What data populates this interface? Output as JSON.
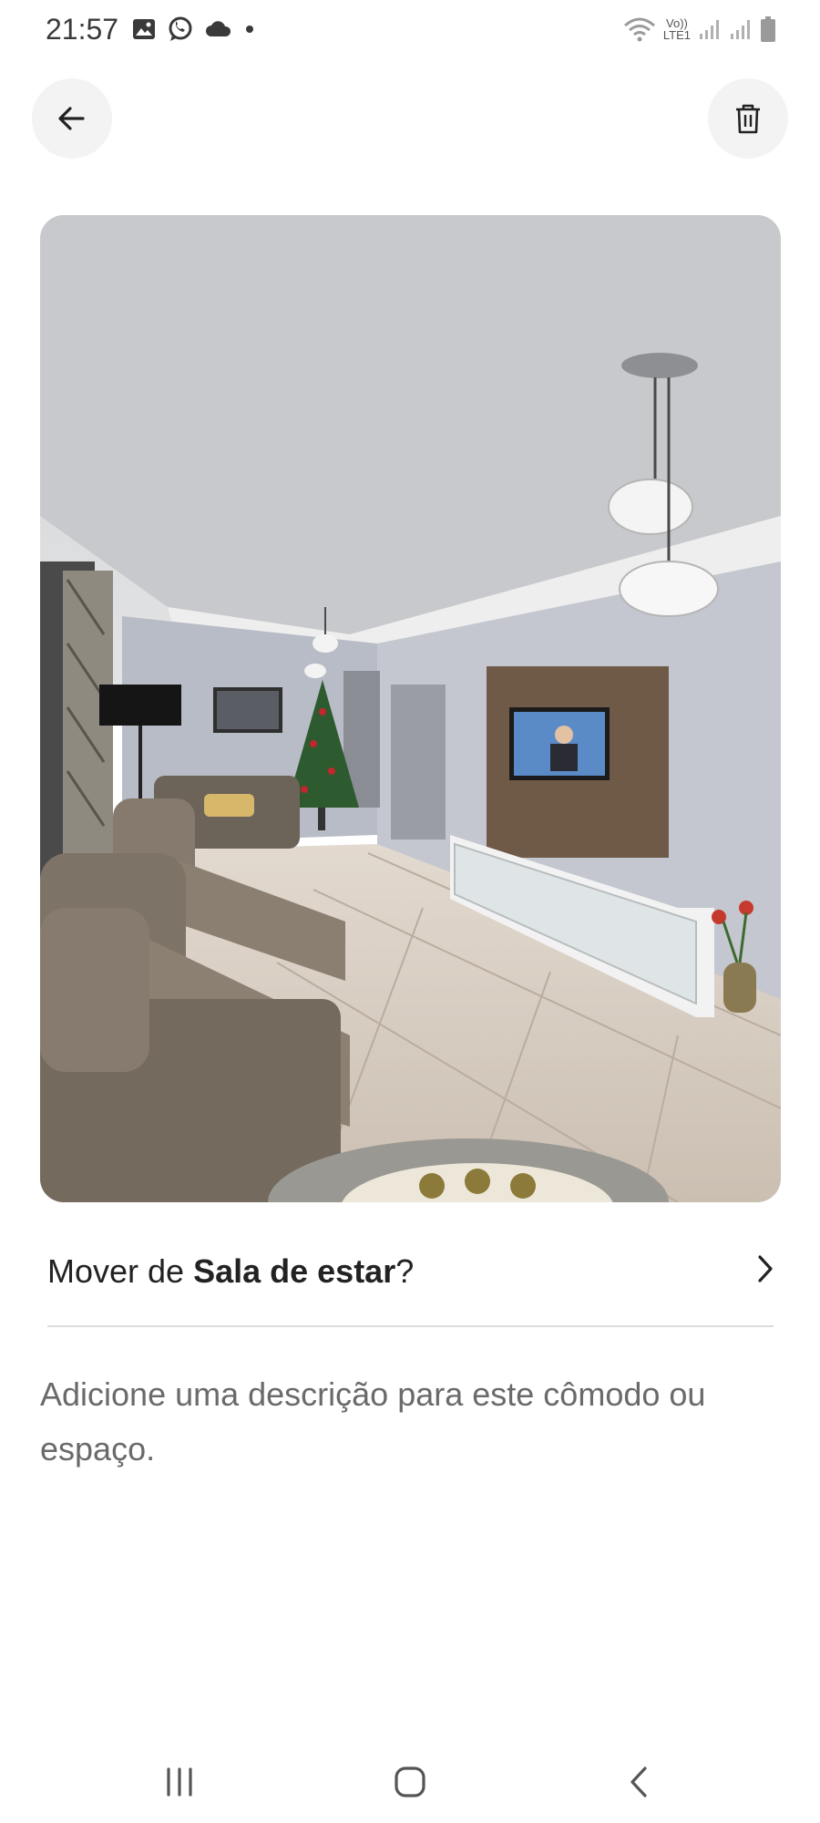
{
  "status_bar": {
    "time": "21:57",
    "left_icons": [
      "gallery-icon",
      "whatsapp-icon",
      "cloud-icon",
      "dot-icon"
    ],
    "network_label_top": "Vo))",
    "network_label_bottom": "LTE1",
    "right_icons": [
      "wifi-icon",
      "signal-icon",
      "signal-icon",
      "battery-icon"
    ]
  },
  "header": {
    "back_icon": "arrow-left-icon",
    "delete_icon": "trash-icon"
  },
  "photo": {
    "subject": "living room photo",
    "colors": {
      "ceiling": "#dcdcdc",
      "wall": "#b9bcc4",
      "floor": "#d8cfc6",
      "sofa": "#7c7266",
      "tv_panel": "#6f5947"
    }
  },
  "move_row": {
    "prefix": "Mover de ",
    "room": "Sala de estar",
    "suffix": "?",
    "icon": "chevron-right-icon"
  },
  "description": {
    "placeholder": "Adicione uma descrição para este cômodo ou espaço."
  },
  "nav_bar": {
    "icons": [
      "recents-icon",
      "home-icon",
      "back-icon"
    ]
  }
}
